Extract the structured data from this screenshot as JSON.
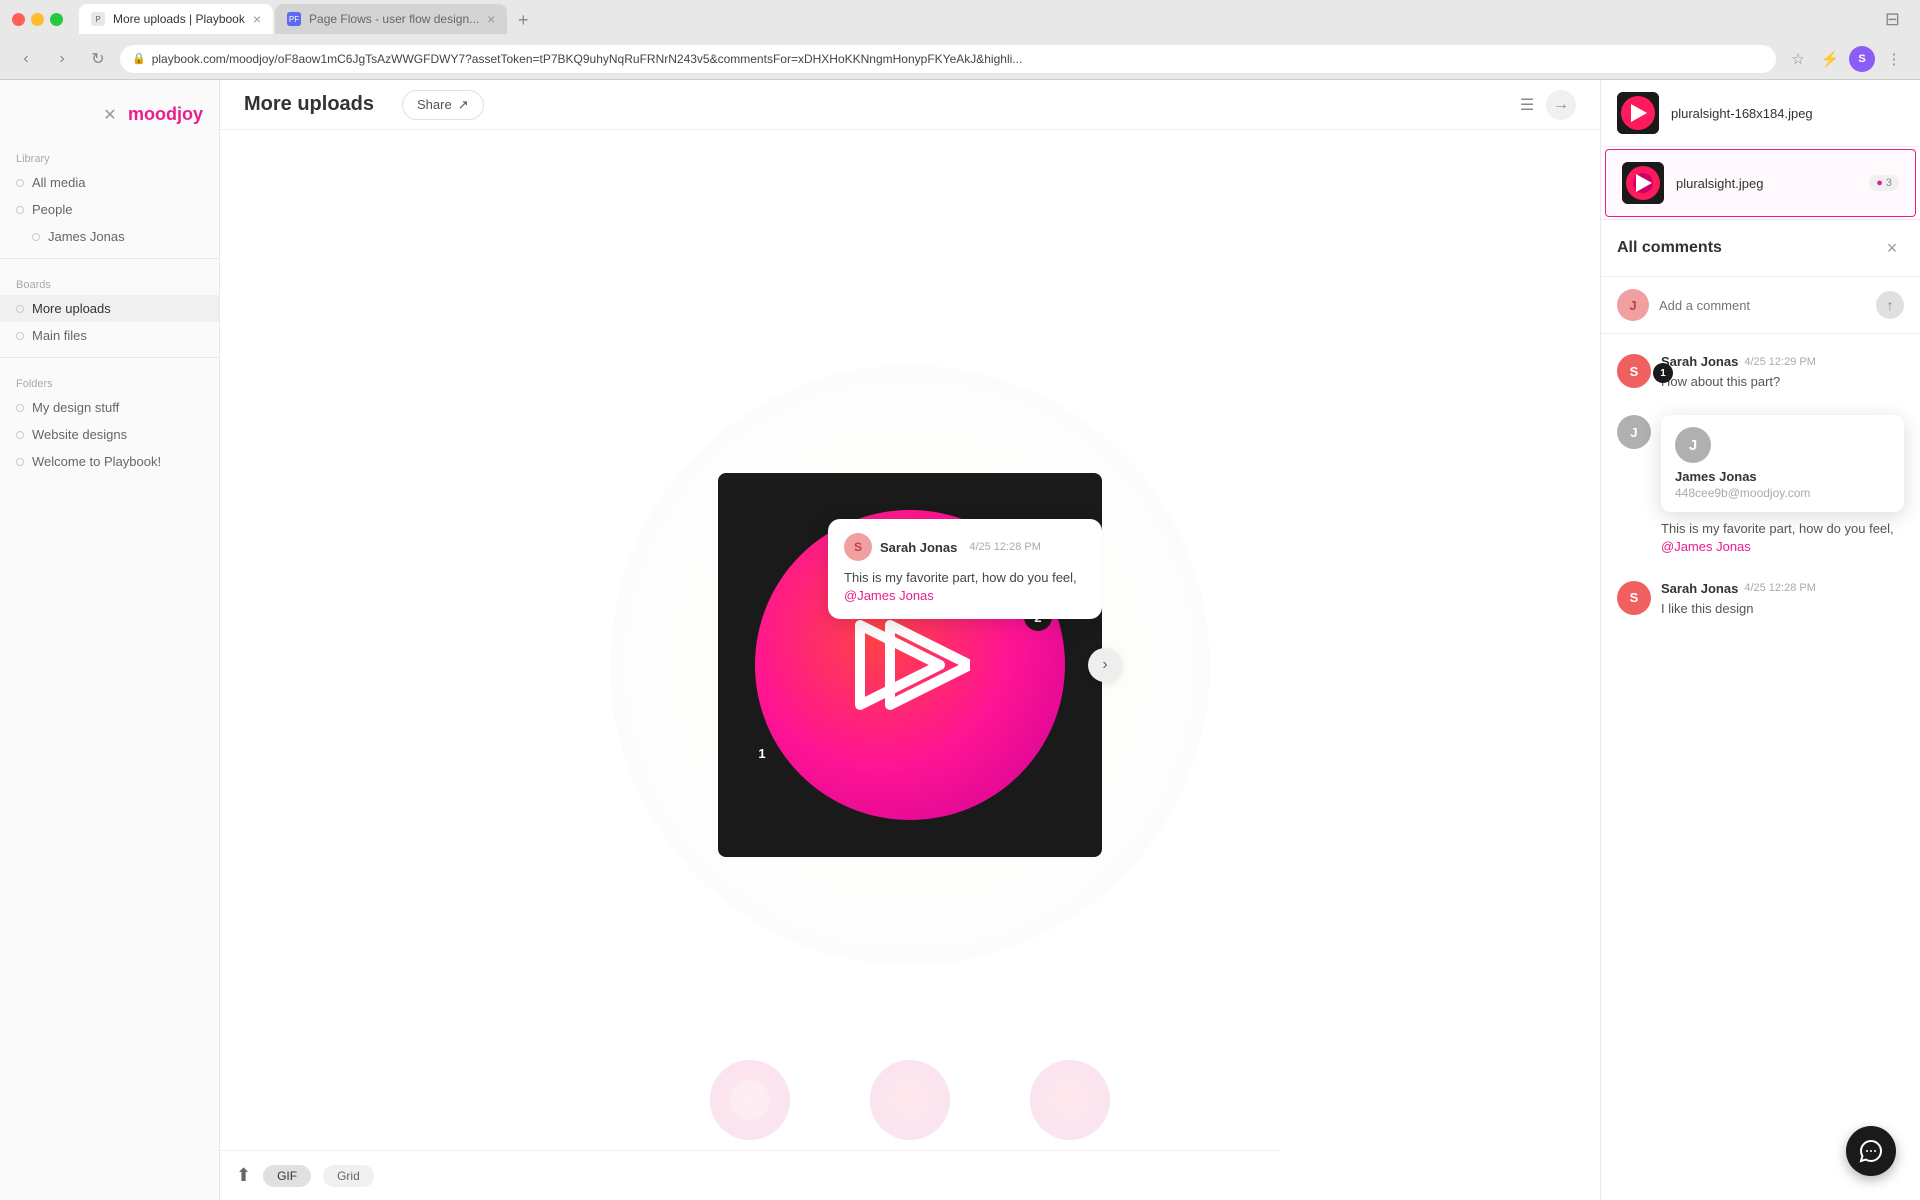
{
  "browser": {
    "tabs": [
      {
        "id": "tab-playbook",
        "title": "More uploads | Playbook",
        "active": true,
        "icon": "playbook"
      },
      {
        "id": "tab-pageflows",
        "title": "Page Flows - user flow design...",
        "active": false,
        "icon": "pageflows"
      }
    ],
    "address": "playbook.com/moodjoy/oF8aow1mC6JgTsAzWWGFDWY7?assetToken=tP7BKQ9uhyNqRuFRNrN243v5&commentsFor=xDHXHoKKNngmHonypFKYeAkJ&highli...",
    "new_tab_label": "+"
  },
  "app": {
    "logo": "moodjoy",
    "close_label": "×"
  },
  "sidebar": {
    "section_library": "Library",
    "items_main": [
      {
        "id": "all-media",
        "label": "All media"
      },
      {
        "id": "people",
        "label": "People"
      },
      {
        "id": "james-jonas",
        "label": "James Jonas",
        "indent": true
      }
    ],
    "section_boards": "Boards",
    "items_boards": [
      {
        "id": "more-uploads",
        "label": "More uploads",
        "active": true
      },
      {
        "id": "main-files",
        "label": "Main files"
      }
    ],
    "section_folders": "Folders",
    "items_folders": [
      {
        "id": "my-design-stuff",
        "label": "My design stuff"
      },
      {
        "id": "website-designs",
        "label": "Website designs"
      },
      {
        "id": "welcome-playbook",
        "label": "Welcome to Playbook!"
      }
    ]
  },
  "main": {
    "title": "More uploads",
    "share_label": "Share",
    "tooltip": {
      "author": "Sarah Jonas",
      "author_initial": "S",
      "time": "4/25 12:28 PM",
      "text": "This is my favorite part, how do you feel, ",
      "mention": "@James Jonas"
    },
    "badge1": "1",
    "badge2": "2"
  },
  "right_panel": {
    "files": [
      {
        "id": "file-pluralsight-168",
        "name": "pluralsight-168x184.jpeg",
        "selected": false,
        "has_comment": false
      },
      {
        "id": "file-pluralsight",
        "name": "pluralsight.jpeg",
        "selected": true,
        "has_comment": true,
        "comment_count": "3"
      }
    ],
    "comments": {
      "title": "All comments",
      "close_label": "×",
      "input_placeholder": "Add a comment",
      "send_icon": "↑",
      "items": [
        {
          "id": "comment-1",
          "author": "Sarah Jonas",
          "author_initial": "S",
          "time": "4/25 12:29 PM",
          "text": "How about this part?",
          "badge": "1",
          "avatar_class": "avatar-sarah"
        },
        {
          "id": "comment-james-popup",
          "author": "James Jonas",
          "author_initial": "J",
          "email": "448cee9b@moodjoy.com",
          "text": "This is my favorite part, how do you feel, ",
          "mention": "@James Jonas",
          "avatar_class": "avatar-james",
          "is_popup": true
        },
        {
          "id": "comment-sarah-2",
          "author": "Sarah Jonas",
          "author_initial": "S",
          "time": "4/25 12:28 PM",
          "text": "I like this design",
          "avatar_class": "avatar-sarah"
        }
      ]
    }
  },
  "bottom": {
    "upload_icon": "⬆",
    "chips": [
      "GIF",
      "Grid"
    ]
  },
  "chat_icon": "💬"
}
